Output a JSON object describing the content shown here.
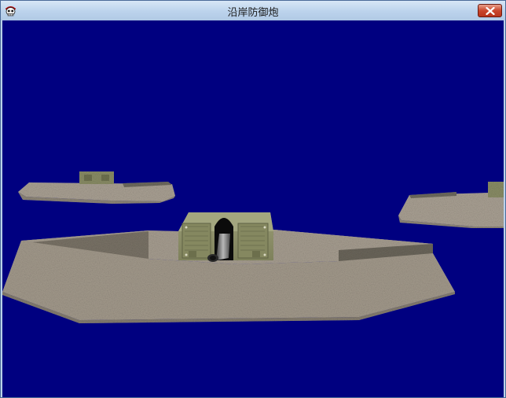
{
  "window": {
    "title": "沿岸防御炮",
    "icon": "skull-bandana-icon",
    "close_icon": "close-icon"
  },
  "scene": {
    "sky_color": "#000080",
    "concrete_color": "#a69c8e",
    "turret_color": "#8c8f68",
    "objects": [
      "coastal-gun-emplacement-main",
      "bunker-left",
      "bunker-right"
    ]
  }
}
